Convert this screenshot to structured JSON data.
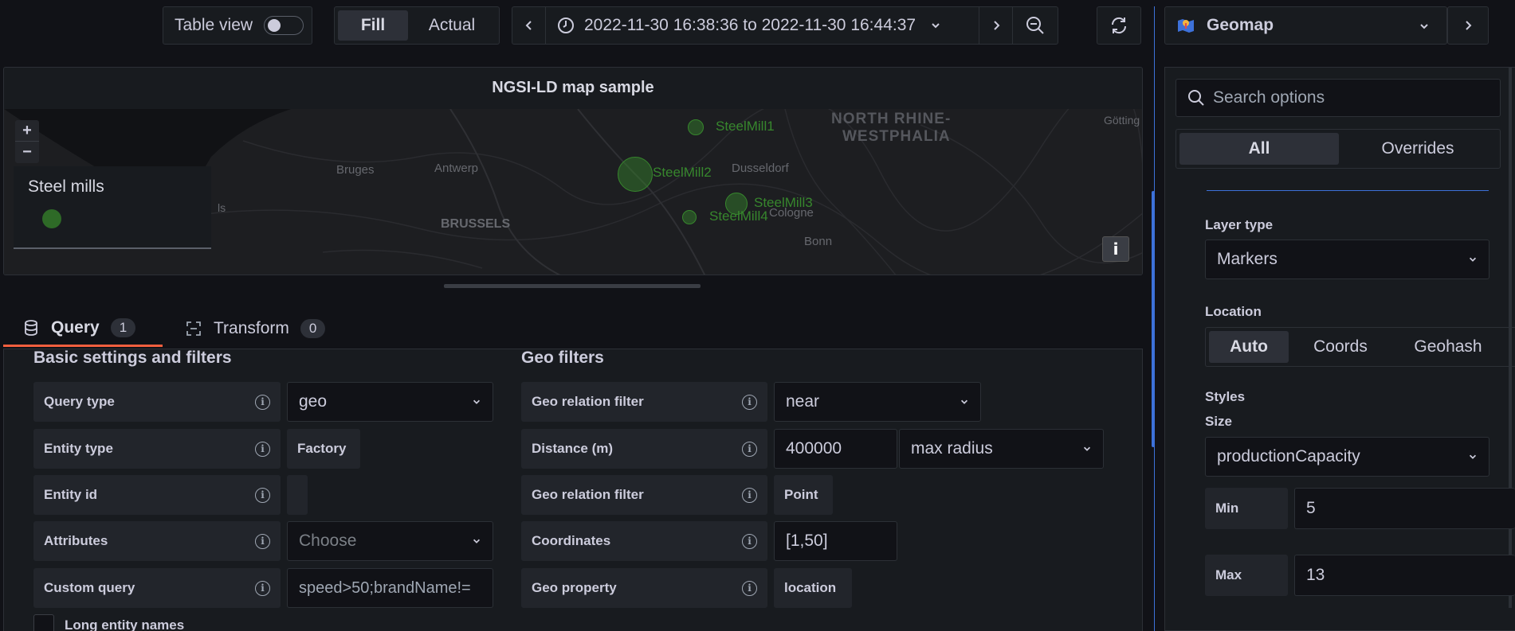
{
  "toolbar": {
    "table_view_label": "Table view",
    "fill_label": "Fill",
    "actual_label": "Actual",
    "time_range": "2022-11-30 16:38:36 to 2022-11-30 16:44:37"
  },
  "panel": {
    "title": "NGSI-LD map sample",
    "legend_title": "Steel mills",
    "zoom_in": "+",
    "zoom_out": "−",
    "info": "i",
    "map_labels": {
      "steelmill1": "SteelMill1",
      "steelmill2": "SteelMill2",
      "steelmill3": "SteelMill3",
      "steelmill4": "SteelMill4",
      "region1": "NORTH RHINE-",
      "region2": "WESTPHALIA",
      "bruges": "Bruges",
      "antwerp": "Antwerp",
      "dusseldorf": "Dusseldorf",
      "brussels": "BRUSSELS",
      "cologne": "Cologne",
      "bonn": "Bonn",
      "gottingen": "Götting",
      "lille": "ls"
    }
  },
  "tabs": {
    "query_label": "Query",
    "query_count": "1",
    "transform_label": "Transform",
    "transform_count": "0"
  },
  "basic": {
    "title": "Basic settings and filters",
    "rows": {
      "query_type": {
        "label": "Query type",
        "value": "geo"
      },
      "entity_type": {
        "label": "Entity type",
        "value": "Factory"
      },
      "entity_id": {
        "label": "Entity id",
        "value": ""
      },
      "attributes": {
        "label": "Attributes",
        "placeholder": "Choose"
      },
      "custom_query": {
        "label": "Custom query",
        "value": "speed>50;brandName!="
      }
    },
    "long_names_label": "Long entity names"
  },
  "geo": {
    "title": "Geo filters",
    "rows": {
      "relation1": {
        "label": "Geo relation filter",
        "value": "near"
      },
      "distance": {
        "label": "Distance (m)",
        "value": "400000",
        "mode": "max radius"
      },
      "relation2": {
        "label": "Geo relation filter",
        "value": "Point"
      },
      "coordinates": {
        "label": "Coordinates",
        "value": "[1,50]"
      },
      "property": {
        "label": "Geo property",
        "value": "location"
      }
    }
  },
  "options": {
    "viz_name": "Geomap",
    "search_placeholder": "Search options",
    "all_label": "All",
    "overrides_label": "Overrides",
    "layer_type_label": "Layer type",
    "layer_type_value": "Markers",
    "location_label": "Location",
    "location_auto": "Auto",
    "location_coords": "Coords",
    "location_geohash": "Geohash",
    "styles_label": "Styles",
    "size_label": "Size",
    "size_value": "productionCapacity",
    "min_label": "Min",
    "min_value": "5",
    "max_label": "Max",
    "max_value": "13"
  },
  "colors": {
    "accent_orange": "#f55f3e",
    "marker_green": "#37872d",
    "scroll_blue": "#3d71d9"
  }
}
